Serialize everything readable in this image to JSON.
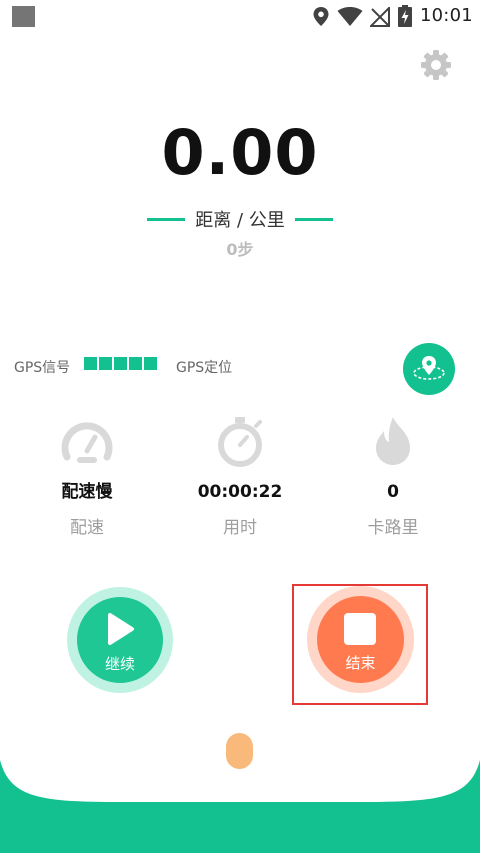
{
  "status_bar": {
    "time": "10:01"
  },
  "main": {
    "distance_value": "0.00",
    "distance_label": "距离 / 公里",
    "steps": "0步"
  },
  "gps": {
    "signal_label": "GPS信号",
    "signal_bars": 5,
    "locate_label": "GPS定位"
  },
  "stats": [
    {
      "value": "配速慢",
      "label": "配速",
      "icon": "speedometer-icon"
    },
    {
      "value": "00:00:22",
      "label": "用时",
      "icon": "stopwatch-icon"
    },
    {
      "value": "0",
      "label": "卡路里",
      "icon": "flame-icon"
    }
  ],
  "controls": {
    "continue_label": "继续",
    "end_label": "结束"
  },
  "colors": {
    "accent_green": "#12c18f",
    "end_orange": "#ff7b4f",
    "highlight_red": "#e53935"
  }
}
